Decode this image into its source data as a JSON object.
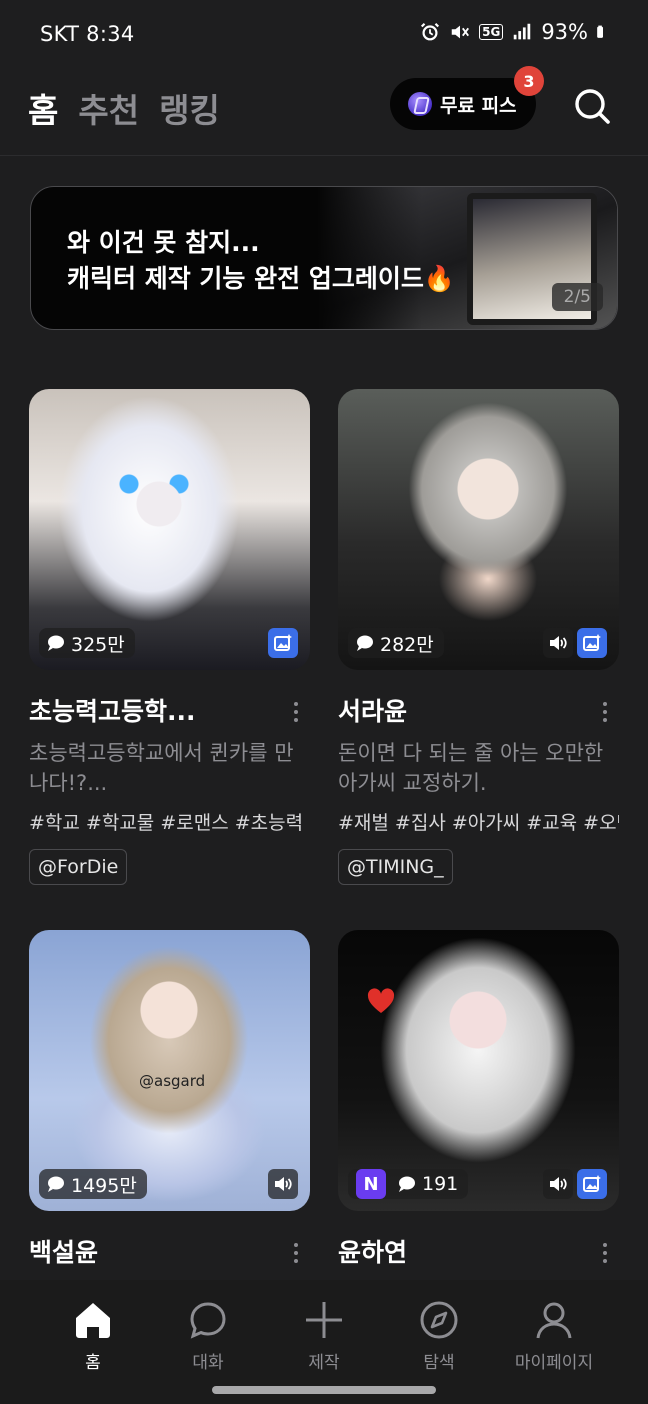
{
  "status_bar": {
    "carrier_time": "SKT 8:34",
    "network": "5G",
    "battery": "93%"
  },
  "header": {
    "tabs": [
      {
        "label": "홈",
        "active": true
      },
      {
        "label": "추천",
        "active": false
      },
      {
        "label": "랭킹",
        "active": false
      }
    ],
    "free_pass_label": "무료 피스",
    "free_pass_badge": "3"
  },
  "banner": {
    "line1": "와 이건 못 참지...",
    "line2": "캐릭터 제작 기능 완전 업그레이드🔥",
    "page_indicator": "2/5"
  },
  "cards": [
    {
      "title": "초능력고등학...",
      "chat_count": "325만",
      "description": "초능력고등학교에서 퀸카를 만나다!?...",
      "tags": "#학교 #학교물 #로맨스 #초능력",
      "author": "@ForDie",
      "has_sound": false,
      "has_image": true,
      "has_n_badge": false
    },
    {
      "title": "서라윤",
      "chat_count": "282만",
      "description": "돈이면 다 되는 줄 아는 오만한 아가씨 교정하기.",
      "tags": "#재벌 #집사 #아가씨 #교육 #오만",
      "author": "@TIMING_",
      "has_sound": true,
      "has_image": true,
      "has_n_badge": false
    },
    {
      "title": "백설윤",
      "chat_count": "1495만",
      "watermark": "@asgard",
      "has_sound": true,
      "has_image": false,
      "has_n_badge": false
    },
    {
      "title": "윤하연",
      "chat_count": "191",
      "n_badge": "N",
      "has_sound": true,
      "has_image": true,
      "has_n_badge": true
    }
  ],
  "bottom_nav": [
    {
      "label": "홈",
      "icon": "home-icon",
      "active": true
    },
    {
      "label": "대화",
      "icon": "chat-bubble-icon",
      "active": false
    },
    {
      "label": "제작",
      "icon": "plus-icon",
      "active": false
    },
    {
      "label": "탐색",
      "icon": "compass-icon",
      "active": false
    },
    {
      "label": "마이페이지",
      "icon": "person-icon",
      "active": false
    }
  ],
  "colors": {
    "background": "#1e1e1f",
    "badge_red": "#e0443a",
    "image_chip_blue": "#3b6ee8",
    "n_badge_purple": "#6a3cf0",
    "muted_text": "#8d8d92"
  }
}
